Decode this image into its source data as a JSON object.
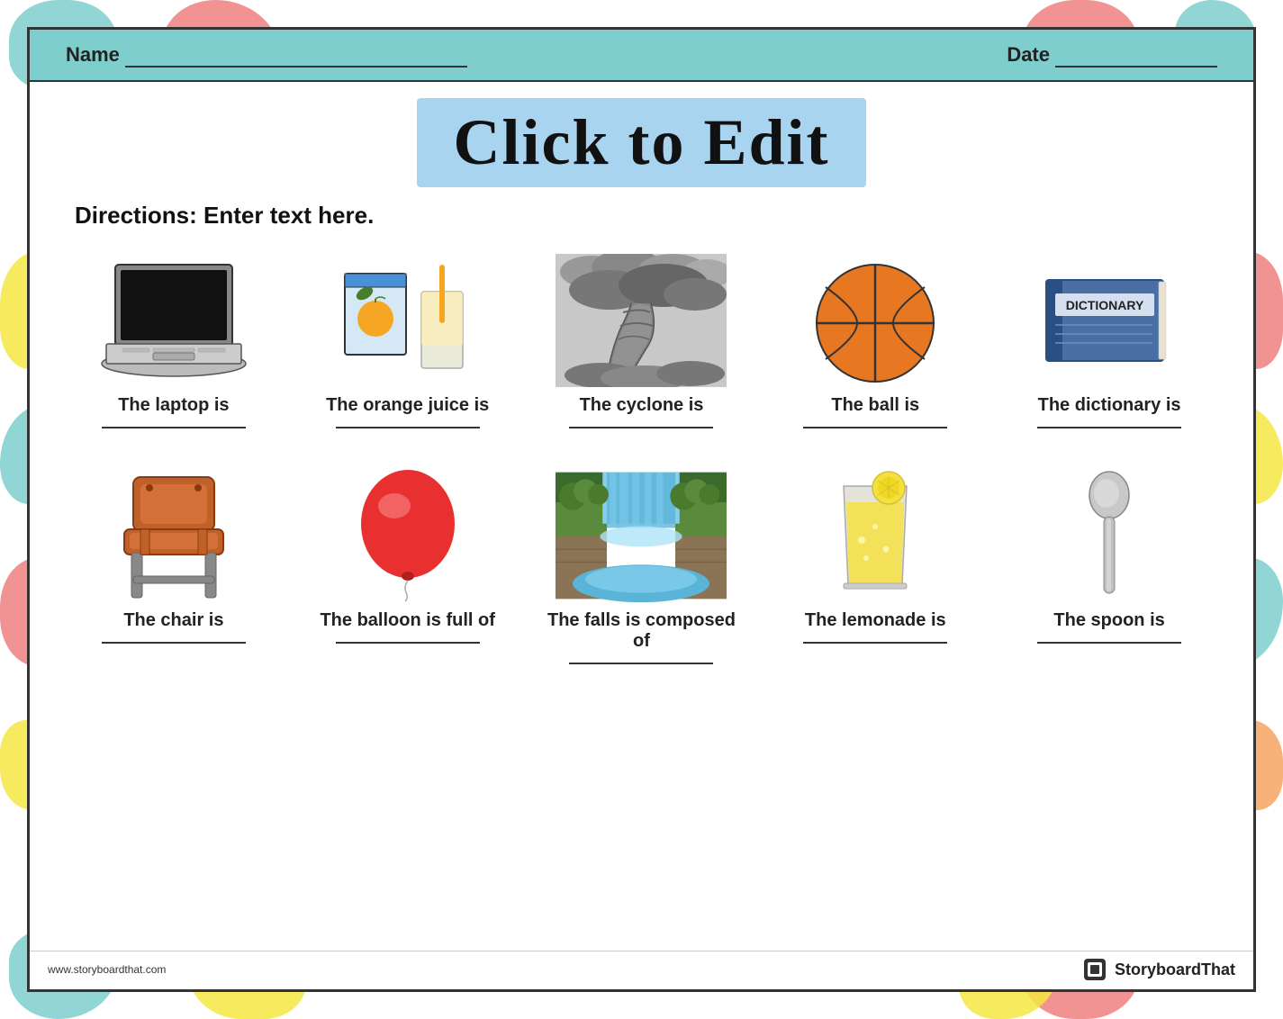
{
  "header": {
    "name_label": "Name",
    "date_label": "Date",
    "background_color": "#7ecece"
  },
  "title": {
    "text": "Click to Edit",
    "background": "#a8d4f0"
  },
  "directions": {
    "text": "Directions: Enter text here."
  },
  "rows": [
    [
      {
        "id": "laptop",
        "label": "The laptop is",
        "image_type": "laptop"
      },
      {
        "id": "orange_juice",
        "label": "The orange juice is",
        "image_type": "orange_juice"
      },
      {
        "id": "cyclone",
        "label": "The cyclone is",
        "image_type": "cyclone"
      },
      {
        "id": "ball",
        "label": "The ball is",
        "image_type": "ball"
      },
      {
        "id": "dictionary",
        "label": "The dictionary is",
        "image_type": "dictionary"
      }
    ],
    [
      {
        "id": "chair",
        "label": "The chair is",
        "image_type": "chair"
      },
      {
        "id": "balloon",
        "label": "The balloon is full of",
        "image_type": "balloon"
      },
      {
        "id": "falls",
        "label": "The falls is composed of",
        "image_type": "falls"
      },
      {
        "id": "lemonade",
        "label": "The lemonade is",
        "image_type": "lemonade"
      },
      {
        "id": "spoon",
        "label": "The spoon is",
        "image_type": "spoon"
      }
    ]
  ],
  "footer": {
    "url": "www.storyboardthat.com",
    "brand": "StoryboardThat"
  }
}
